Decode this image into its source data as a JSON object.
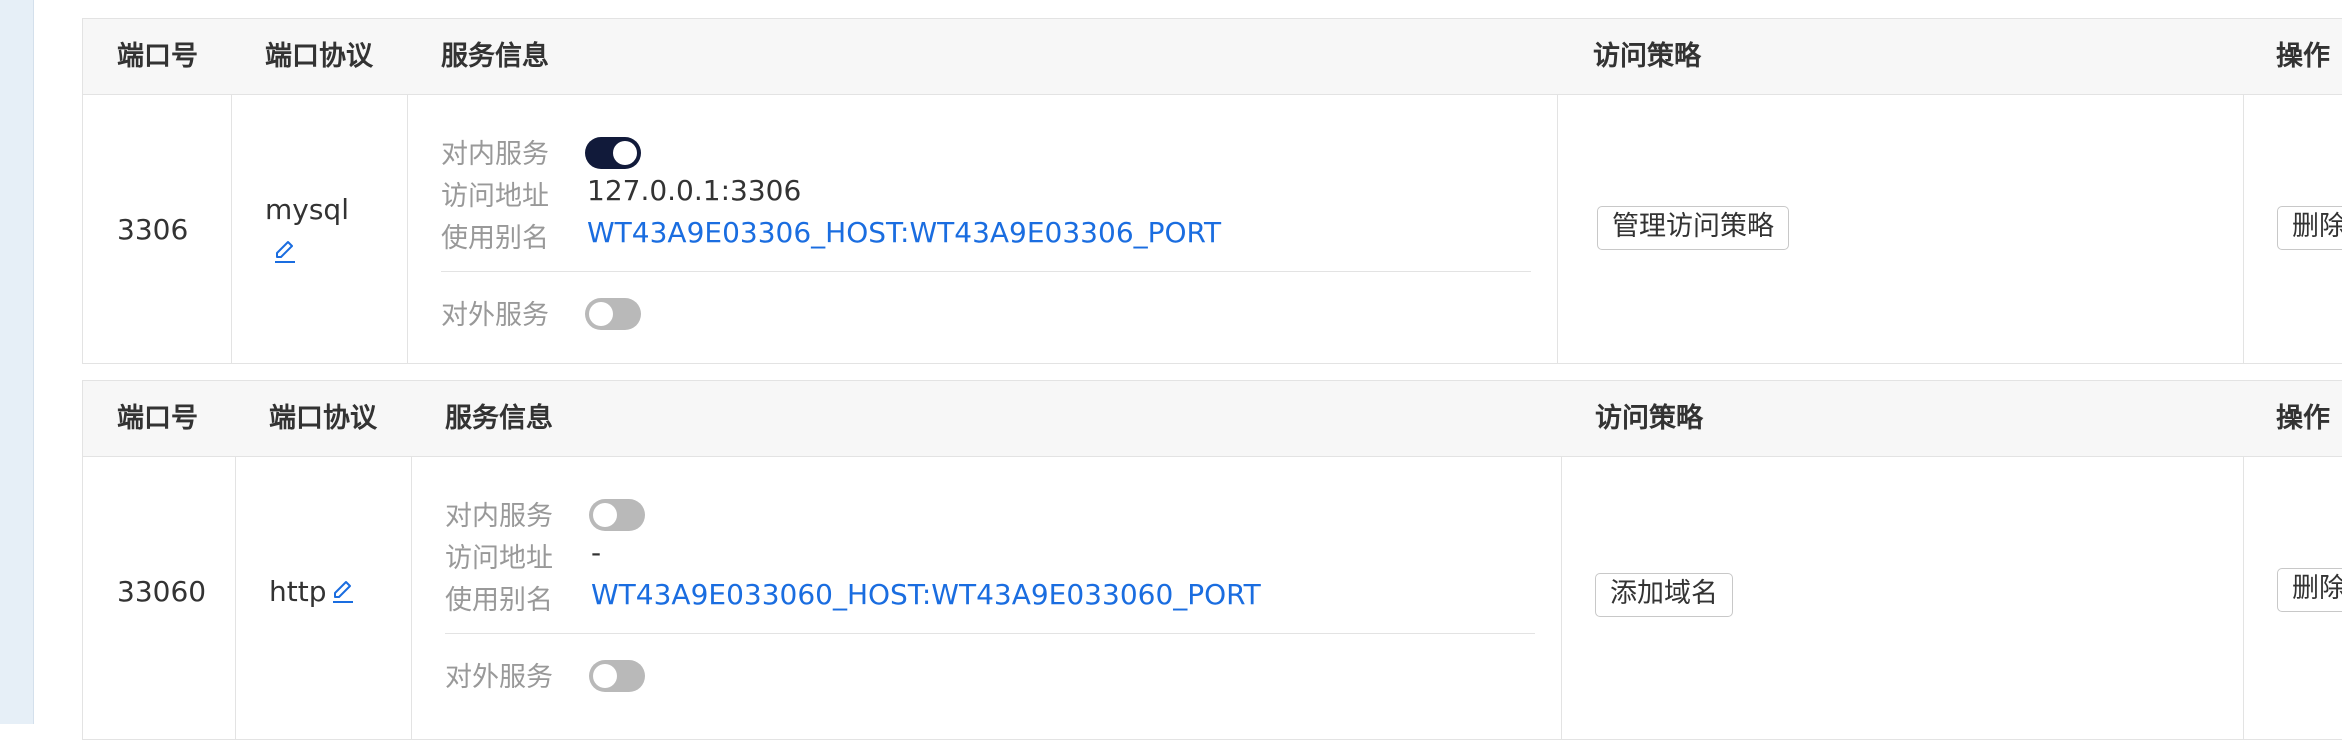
{
  "headers": {
    "port": "端口号",
    "protocol": "端口协议",
    "service_info": "服务信息",
    "access_policy": "访问策略",
    "actions": "操作"
  },
  "service_labels": {
    "internal": "对内服务",
    "address": "访问地址",
    "alias": "使用别名",
    "external": "对外服务"
  },
  "rows": [
    {
      "port": "3306",
      "protocol": "mysql",
      "internal_enabled": true,
      "address": "127.0.0.1:3306",
      "alias": "WT43A9E03306_HOST:WT43A9E03306_PORT",
      "external_enabled": false,
      "policy_button": "管理访问策略",
      "action_button": "删除"
    },
    {
      "port": "33060",
      "protocol": "http",
      "internal_enabled": false,
      "address": "-",
      "alias": "WT43A9E033060_HOST:WT43A9E033060_PORT",
      "external_enabled": false,
      "policy_button": "添加域名",
      "action_button": "删除"
    }
  ],
  "colors": {
    "toggle_on": "#111a3a",
    "toggle_off": "#b9b9b9",
    "link": "#1a6de0"
  }
}
